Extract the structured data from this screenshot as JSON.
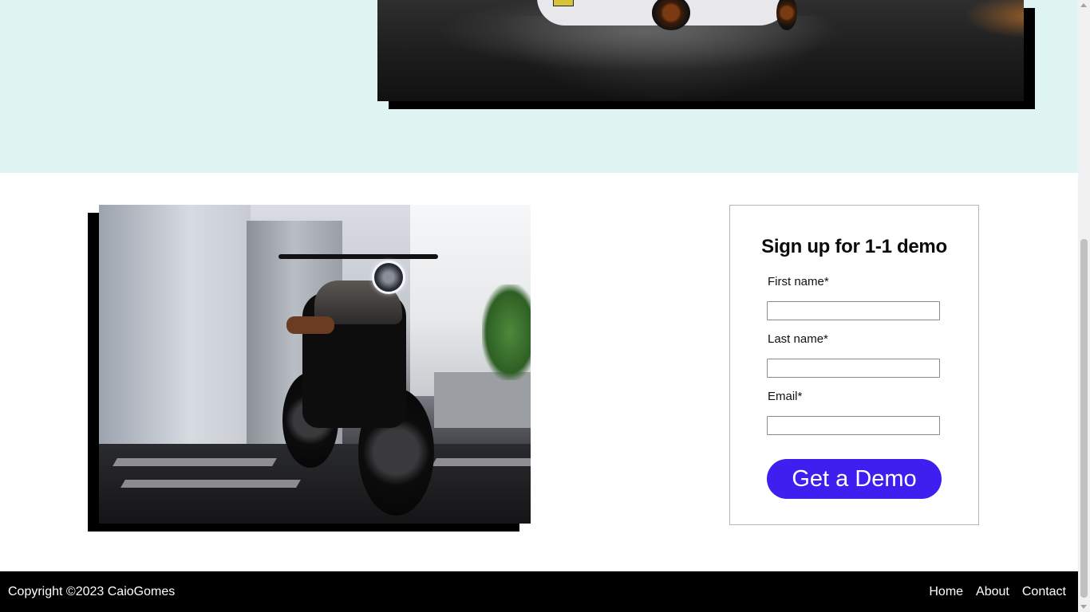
{
  "signup": {
    "title": "Sign up for 1-1 demo",
    "first_name_label": "First name*",
    "first_name_value": "",
    "last_name_label": "Last name*",
    "last_name_value": "",
    "email_label": "Email*",
    "email_value": "",
    "submit_label": "Get a Demo"
  },
  "footer": {
    "copyright": "Copyright ©2023 CaioGomes",
    "nav": [
      "Home",
      "About",
      "Contact"
    ]
  },
  "colors": {
    "hero_band": "#def4f2",
    "button": "#3d1ff0",
    "footer": "#000000"
  },
  "images": {
    "car": "car-photo",
    "motorcycle": "motorcycle-photo"
  }
}
